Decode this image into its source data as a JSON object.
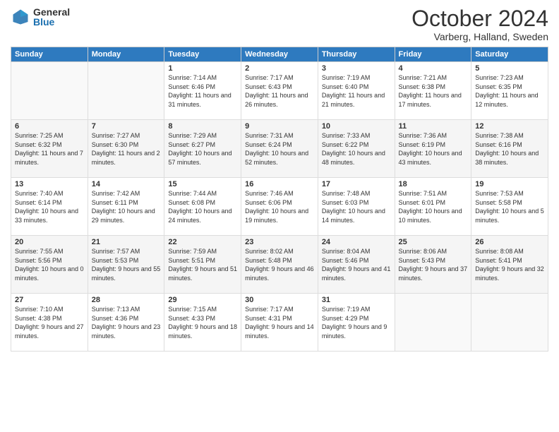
{
  "logo": {
    "general": "General",
    "blue": "Blue"
  },
  "title": "October 2024",
  "location": "Varberg, Halland, Sweden",
  "days_of_week": [
    "Sunday",
    "Monday",
    "Tuesday",
    "Wednesday",
    "Thursday",
    "Friday",
    "Saturday"
  ],
  "weeks": [
    [
      {
        "day": "",
        "content": ""
      },
      {
        "day": "",
        "content": ""
      },
      {
        "day": "1",
        "content": "Sunrise: 7:14 AM\nSunset: 6:46 PM\nDaylight: 11 hours and 31 minutes."
      },
      {
        "day": "2",
        "content": "Sunrise: 7:17 AM\nSunset: 6:43 PM\nDaylight: 11 hours and 26 minutes."
      },
      {
        "day": "3",
        "content": "Sunrise: 7:19 AM\nSunset: 6:40 PM\nDaylight: 11 hours and 21 minutes."
      },
      {
        "day": "4",
        "content": "Sunrise: 7:21 AM\nSunset: 6:38 PM\nDaylight: 11 hours and 17 minutes."
      },
      {
        "day": "5",
        "content": "Sunrise: 7:23 AM\nSunset: 6:35 PM\nDaylight: 11 hours and 12 minutes."
      }
    ],
    [
      {
        "day": "6",
        "content": "Sunrise: 7:25 AM\nSunset: 6:32 PM\nDaylight: 11 hours and 7 minutes."
      },
      {
        "day": "7",
        "content": "Sunrise: 7:27 AM\nSunset: 6:30 PM\nDaylight: 11 hours and 2 minutes."
      },
      {
        "day": "8",
        "content": "Sunrise: 7:29 AM\nSunset: 6:27 PM\nDaylight: 10 hours and 57 minutes."
      },
      {
        "day": "9",
        "content": "Sunrise: 7:31 AM\nSunset: 6:24 PM\nDaylight: 10 hours and 52 minutes."
      },
      {
        "day": "10",
        "content": "Sunrise: 7:33 AM\nSunset: 6:22 PM\nDaylight: 10 hours and 48 minutes."
      },
      {
        "day": "11",
        "content": "Sunrise: 7:36 AM\nSunset: 6:19 PM\nDaylight: 10 hours and 43 minutes."
      },
      {
        "day": "12",
        "content": "Sunrise: 7:38 AM\nSunset: 6:16 PM\nDaylight: 10 hours and 38 minutes."
      }
    ],
    [
      {
        "day": "13",
        "content": "Sunrise: 7:40 AM\nSunset: 6:14 PM\nDaylight: 10 hours and 33 minutes."
      },
      {
        "day": "14",
        "content": "Sunrise: 7:42 AM\nSunset: 6:11 PM\nDaylight: 10 hours and 29 minutes."
      },
      {
        "day": "15",
        "content": "Sunrise: 7:44 AM\nSunset: 6:08 PM\nDaylight: 10 hours and 24 minutes."
      },
      {
        "day": "16",
        "content": "Sunrise: 7:46 AM\nSunset: 6:06 PM\nDaylight: 10 hours and 19 minutes."
      },
      {
        "day": "17",
        "content": "Sunrise: 7:48 AM\nSunset: 6:03 PM\nDaylight: 10 hours and 14 minutes."
      },
      {
        "day": "18",
        "content": "Sunrise: 7:51 AM\nSunset: 6:01 PM\nDaylight: 10 hours and 10 minutes."
      },
      {
        "day": "19",
        "content": "Sunrise: 7:53 AM\nSunset: 5:58 PM\nDaylight: 10 hours and 5 minutes."
      }
    ],
    [
      {
        "day": "20",
        "content": "Sunrise: 7:55 AM\nSunset: 5:56 PM\nDaylight: 10 hours and 0 minutes."
      },
      {
        "day": "21",
        "content": "Sunrise: 7:57 AM\nSunset: 5:53 PM\nDaylight: 9 hours and 55 minutes."
      },
      {
        "day": "22",
        "content": "Sunrise: 7:59 AM\nSunset: 5:51 PM\nDaylight: 9 hours and 51 minutes."
      },
      {
        "day": "23",
        "content": "Sunrise: 8:02 AM\nSunset: 5:48 PM\nDaylight: 9 hours and 46 minutes."
      },
      {
        "day": "24",
        "content": "Sunrise: 8:04 AM\nSunset: 5:46 PM\nDaylight: 9 hours and 41 minutes."
      },
      {
        "day": "25",
        "content": "Sunrise: 8:06 AM\nSunset: 5:43 PM\nDaylight: 9 hours and 37 minutes."
      },
      {
        "day": "26",
        "content": "Sunrise: 8:08 AM\nSunset: 5:41 PM\nDaylight: 9 hours and 32 minutes."
      }
    ],
    [
      {
        "day": "27",
        "content": "Sunrise: 7:10 AM\nSunset: 4:38 PM\nDaylight: 9 hours and 27 minutes."
      },
      {
        "day": "28",
        "content": "Sunrise: 7:13 AM\nSunset: 4:36 PM\nDaylight: 9 hours and 23 minutes."
      },
      {
        "day": "29",
        "content": "Sunrise: 7:15 AM\nSunset: 4:33 PM\nDaylight: 9 hours and 18 minutes."
      },
      {
        "day": "30",
        "content": "Sunrise: 7:17 AM\nSunset: 4:31 PM\nDaylight: 9 hours and 14 minutes."
      },
      {
        "day": "31",
        "content": "Sunrise: 7:19 AM\nSunset: 4:29 PM\nDaylight: 9 hours and 9 minutes."
      },
      {
        "day": "",
        "content": ""
      },
      {
        "day": "",
        "content": ""
      }
    ]
  ]
}
